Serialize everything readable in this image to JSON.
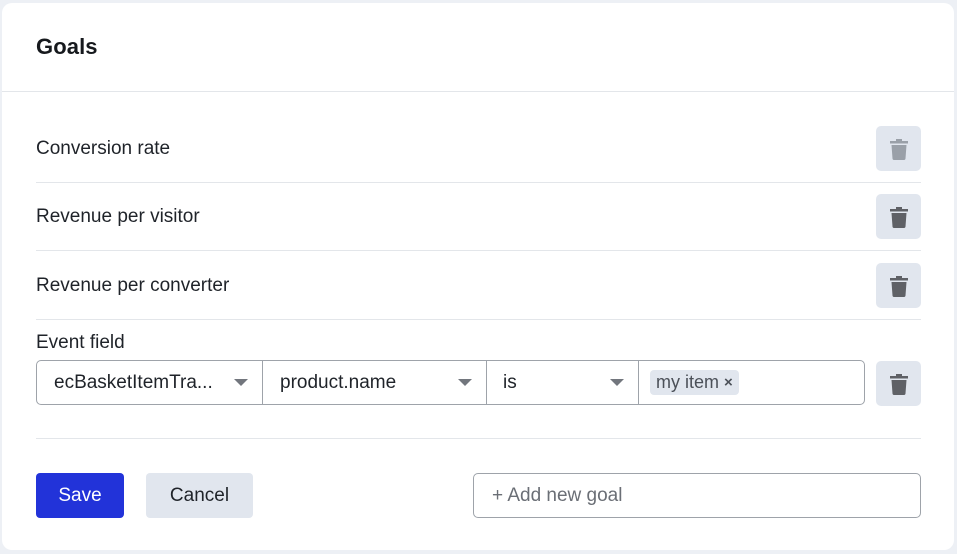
{
  "card": {
    "title": "Goals"
  },
  "goals": [
    {
      "label": "Conversion rate",
      "delete_disabled": true,
      "icon": "trash-icon"
    },
    {
      "label": "Revenue per visitor",
      "delete_disabled": false,
      "icon": "trash-icon"
    },
    {
      "label": "Revenue per converter",
      "delete_disabled": false,
      "icon": "trash-icon"
    }
  ],
  "event_field": {
    "label": "Event field",
    "event_select": "ecBasketItemTra...",
    "property_select": "product.name",
    "operator_select": "is",
    "values": [
      {
        "label": "my item",
        "remove_icon": "×"
      }
    ],
    "delete_icon": "trash-icon"
  },
  "actions": {
    "save_label": "Save",
    "cancel_label": "Cancel",
    "add_goal_placeholder": "+ Add new goal"
  },
  "colors": {
    "primary": "#2233d9",
    "secondary_bg": "#e1e6ee",
    "border": "#9ea3aa",
    "page_bg": "#edf0f5"
  }
}
